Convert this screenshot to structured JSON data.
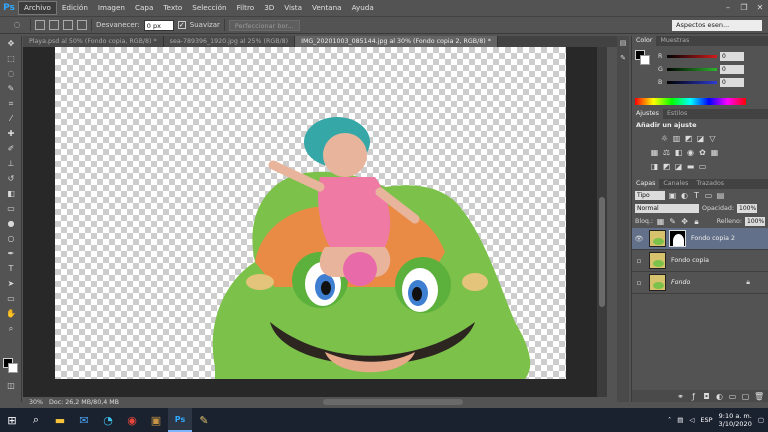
{
  "app": {
    "logo": "Ps"
  },
  "menu": [
    "Archivo",
    "Edición",
    "Imagen",
    "Capa",
    "Texto",
    "Selección",
    "Filtro",
    "3D",
    "Vista",
    "Ventana",
    "Ayuda"
  ],
  "window_controls": {
    "minimize": "–",
    "maximize": "❐",
    "close": "✕"
  },
  "options_bar": {
    "feather_label": "Desvanecer:",
    "feather_value": "0 px",
    "antialias_label": "Suavizar",
    "refine_button": "Perfeccionar bor...",
    "workspace": "Aspectos esen..."
  },
  "doc_tabs": [
    "Playa.psd al 50% (Fondo copia, RGB/8) *",
    "sea-789396_1920.jpg al 25% (RGB/8)",
    "IMG_20201003_085144.jpg al 30% (Fondo copia 2, RGB/8) *"
  ],
  "status": {
    "zoom": "30%",
    "doc": "Doc: 26,2 MB/80,4 MB"
  },
  "color_panel": {
    "tabs": [
      "Color",
      "Muestras"
    ],
    "sliders": [
      {
        "label": "R",
        "value": "0",
        "color": "#d21c1c"
      },
      {
        "label": "G",
        "value": "0",
        "color": "#2db62d"
      },
      {
        "label": "B",
        "value": "0",
        "color": "#2d3bd6"
      }
    ]
  },
  "adjustments_panel": {
    "tabs": [
      "Ajustes",
      "Estilos"
    ],
    "heading": "Añadir un ajuste"
  },
  "layers_panel": {
    "tabs": [
      "Capas",
      "Canales",
      "Trazados"
    ],
    "filter": "Tipo",
    "blend_mode": "Normal",
    "opacity_label": "Opacidad:",
    "opacity_value": "100%",
    "lock_label": "Bloq.:",
    "fill_label": "Relleno:",
    "fill_value": "100%",
    "layers": [
      {
        "name": "Fondo copia 2",
        "visible": true,
        "selected": true,
        "mask": true
      },
      {
        "name": "Fondo copia",
        "visible": false,
        "selected": false,
        "mask": false
      },
      {
        "name": "Fondo",
        "visible": false,
        "selected": false,
        "mask": false,
        "locked": true
      }
    ]
  },
  "taskbar": {
    "language": "ESP",
    "time": "9:10 a. m.",
    "date": "3/10/2020"
  }
}
